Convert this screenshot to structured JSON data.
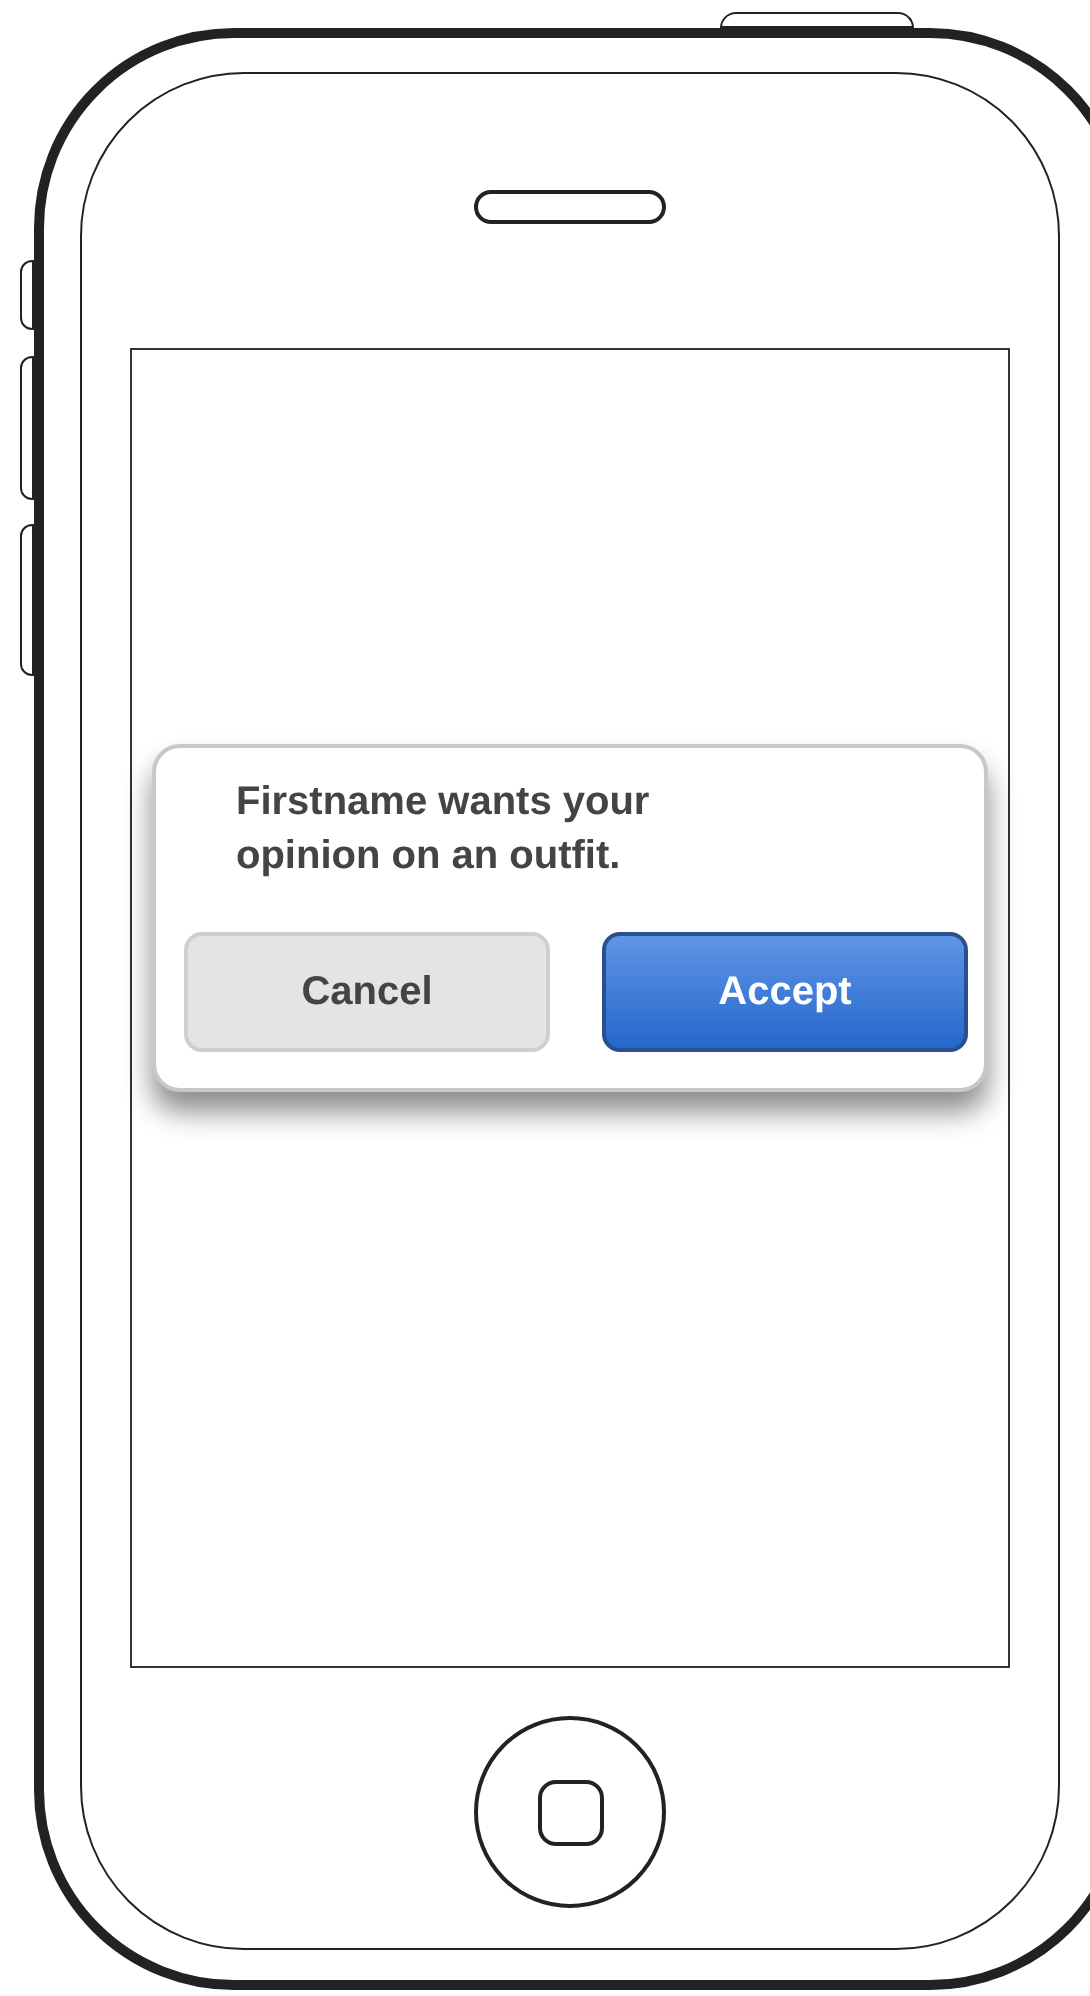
{
  "dialog": {
    "message": "Firstname wants your opinion on an outfit.",
    "buttons": [
      {
        "label": "Cancel",
        "kind": "secondary"
      },
      {
        "label": "Accept",
        "kind": "primary"
      }
    ]
  }
}
